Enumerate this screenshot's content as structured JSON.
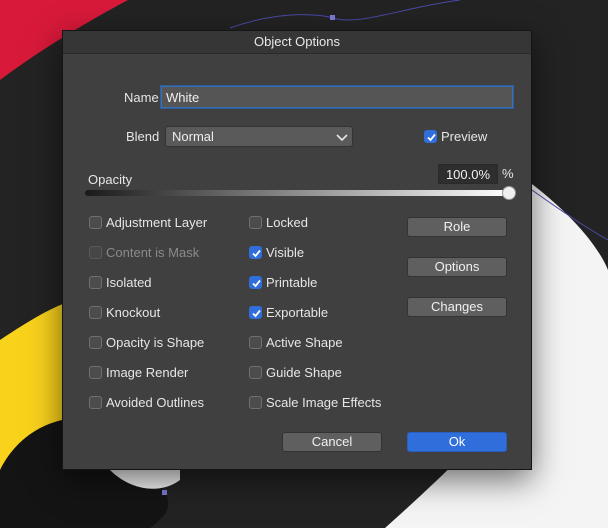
{
  "dialog": {
    "title": "Object Options"
  },
  "name": {
    "label": "Name",
    "value": "White"
  },
  "blend": {
    "label": "Blend",
    "value": "Normal"
  },
  "preview": {
    "label": "Preview",
    "checked": true
  },
  "opacity": {
    "label": "Opacity",
    "value": "100.0%",
    "unit": "%",
    "level": 1.0
  },
  "checkboxes_left": [
    {
      "label": "Adjustment Layer",
      "checked": false,
      "disabled": false
    },
    {
      "label": "Content is Mask",
      "checked": false,
      "disabled": true
    },
    {
      "label": "Isolated",
      "checked": false,
      "disabled": false
    },
    {
      "label": "Knockout",
      "checked": false,
      "disabled": false
    },
    {
      "label": "Opacity is Shape",
      "checked": false,
      "disabled": false
    },
    {
      "label": "Image Render",
      "checked": false,
      "disabled": false
    },
    {
      "label": "Avoided Outlines",
      "checked": false,
      "disabled": false
    }
  ],
  "checkboxes_mid": [
    {
      "label": "Locked",
      "checked": false,
      "disabled": false
    },
    {
      "label": "Visible",
      "checked": true,
      "disabled": false
    },
    {
      "label": "Printable",
      "checked": true,
      "disabled": false
    },
    {
      "label": "Exportable",
      "checked": true,
      "disabled": false
    },
    {
      "label": "Active Shape",
      "checked": false,
      "disabled": false
    },
    {
      "label": "Guide Shape",
      "checked": false,
      "disabled": false
    },
    {
      "label": "Scale Image Effects",
      "checked": false,
      "disabled": false
    }
  ],
  "buttons": {
    "role": "Role",
    "options": "Options",
    "changes": "Changes",
    "cancel": "Cancel",
    "ok": "Ok"
  },
  "colors": {
    "accent": "#2f6edb",
    "canvas_red": "#d8193a",
    "canvas_yellow": "#f9d21c",
    "canvas_black": "#1a1a1a",
    "canvas_white": "#ffffff"
  }
}
